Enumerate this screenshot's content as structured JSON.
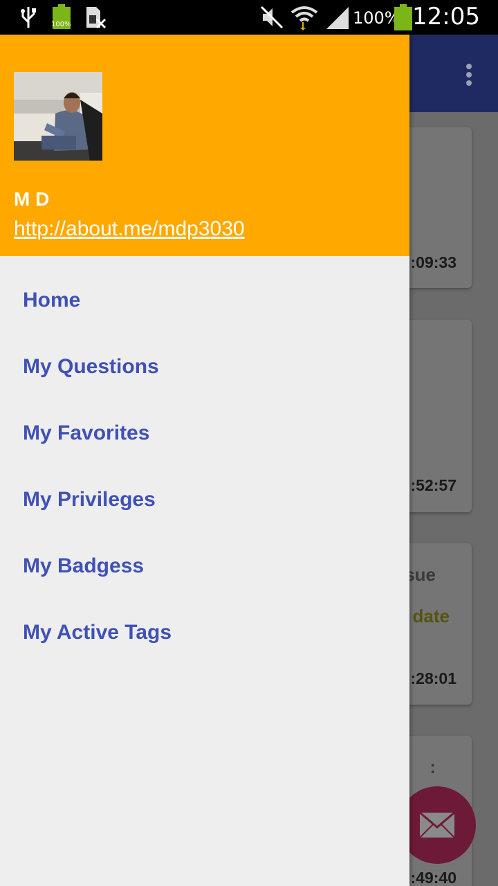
{
  "status_bar": {
    "battery_percent": "100%",
    "battery_small_label": "100%",
    "time": "12:05",
    "icons": [
      "usb-icon",
      "battery-small-icon",
      "sim-off-icon",
      "mute-icon",
      "wifi-icon",
      "signal-icon",
      "battery-icon"
    ]
  },
  "drawer": {
    "user": {
      "name": "M D",
      "link": "http://about.me/mdp3030"
    },
    "items": [
      {
        "label": "Home"
      },
      {
        "label": "My Questions"
      },
      {
        "label": "My Favorites"
      },
      {
        "label": "My Privileges"
      },
      {
        "label": "My Badgess"
      },
      {
        "label": "My Active Tags"
      }
    ]
  },
  "background": {
    "cards": [
      {
        "time": ":09:33"
      },
      {
        "time": ":52:57"
      },
      {
        "time": ":28:01",
        "fragment_1": "sue",
        "fragment_2": "date"
      },
      {
        "time": ":49:40",
        "fragment_1": ":"
      }
    ],
    "fab_icon": "envelope-icon"
  },
  "colors": {
    "drawer_header": "#ffa800",
    "nav_text": "#3f51b5",
    "app_bar": "#1f2a63",
    "fab": "#6d1a38",
    "battery": "#7cb518"
  }
}
